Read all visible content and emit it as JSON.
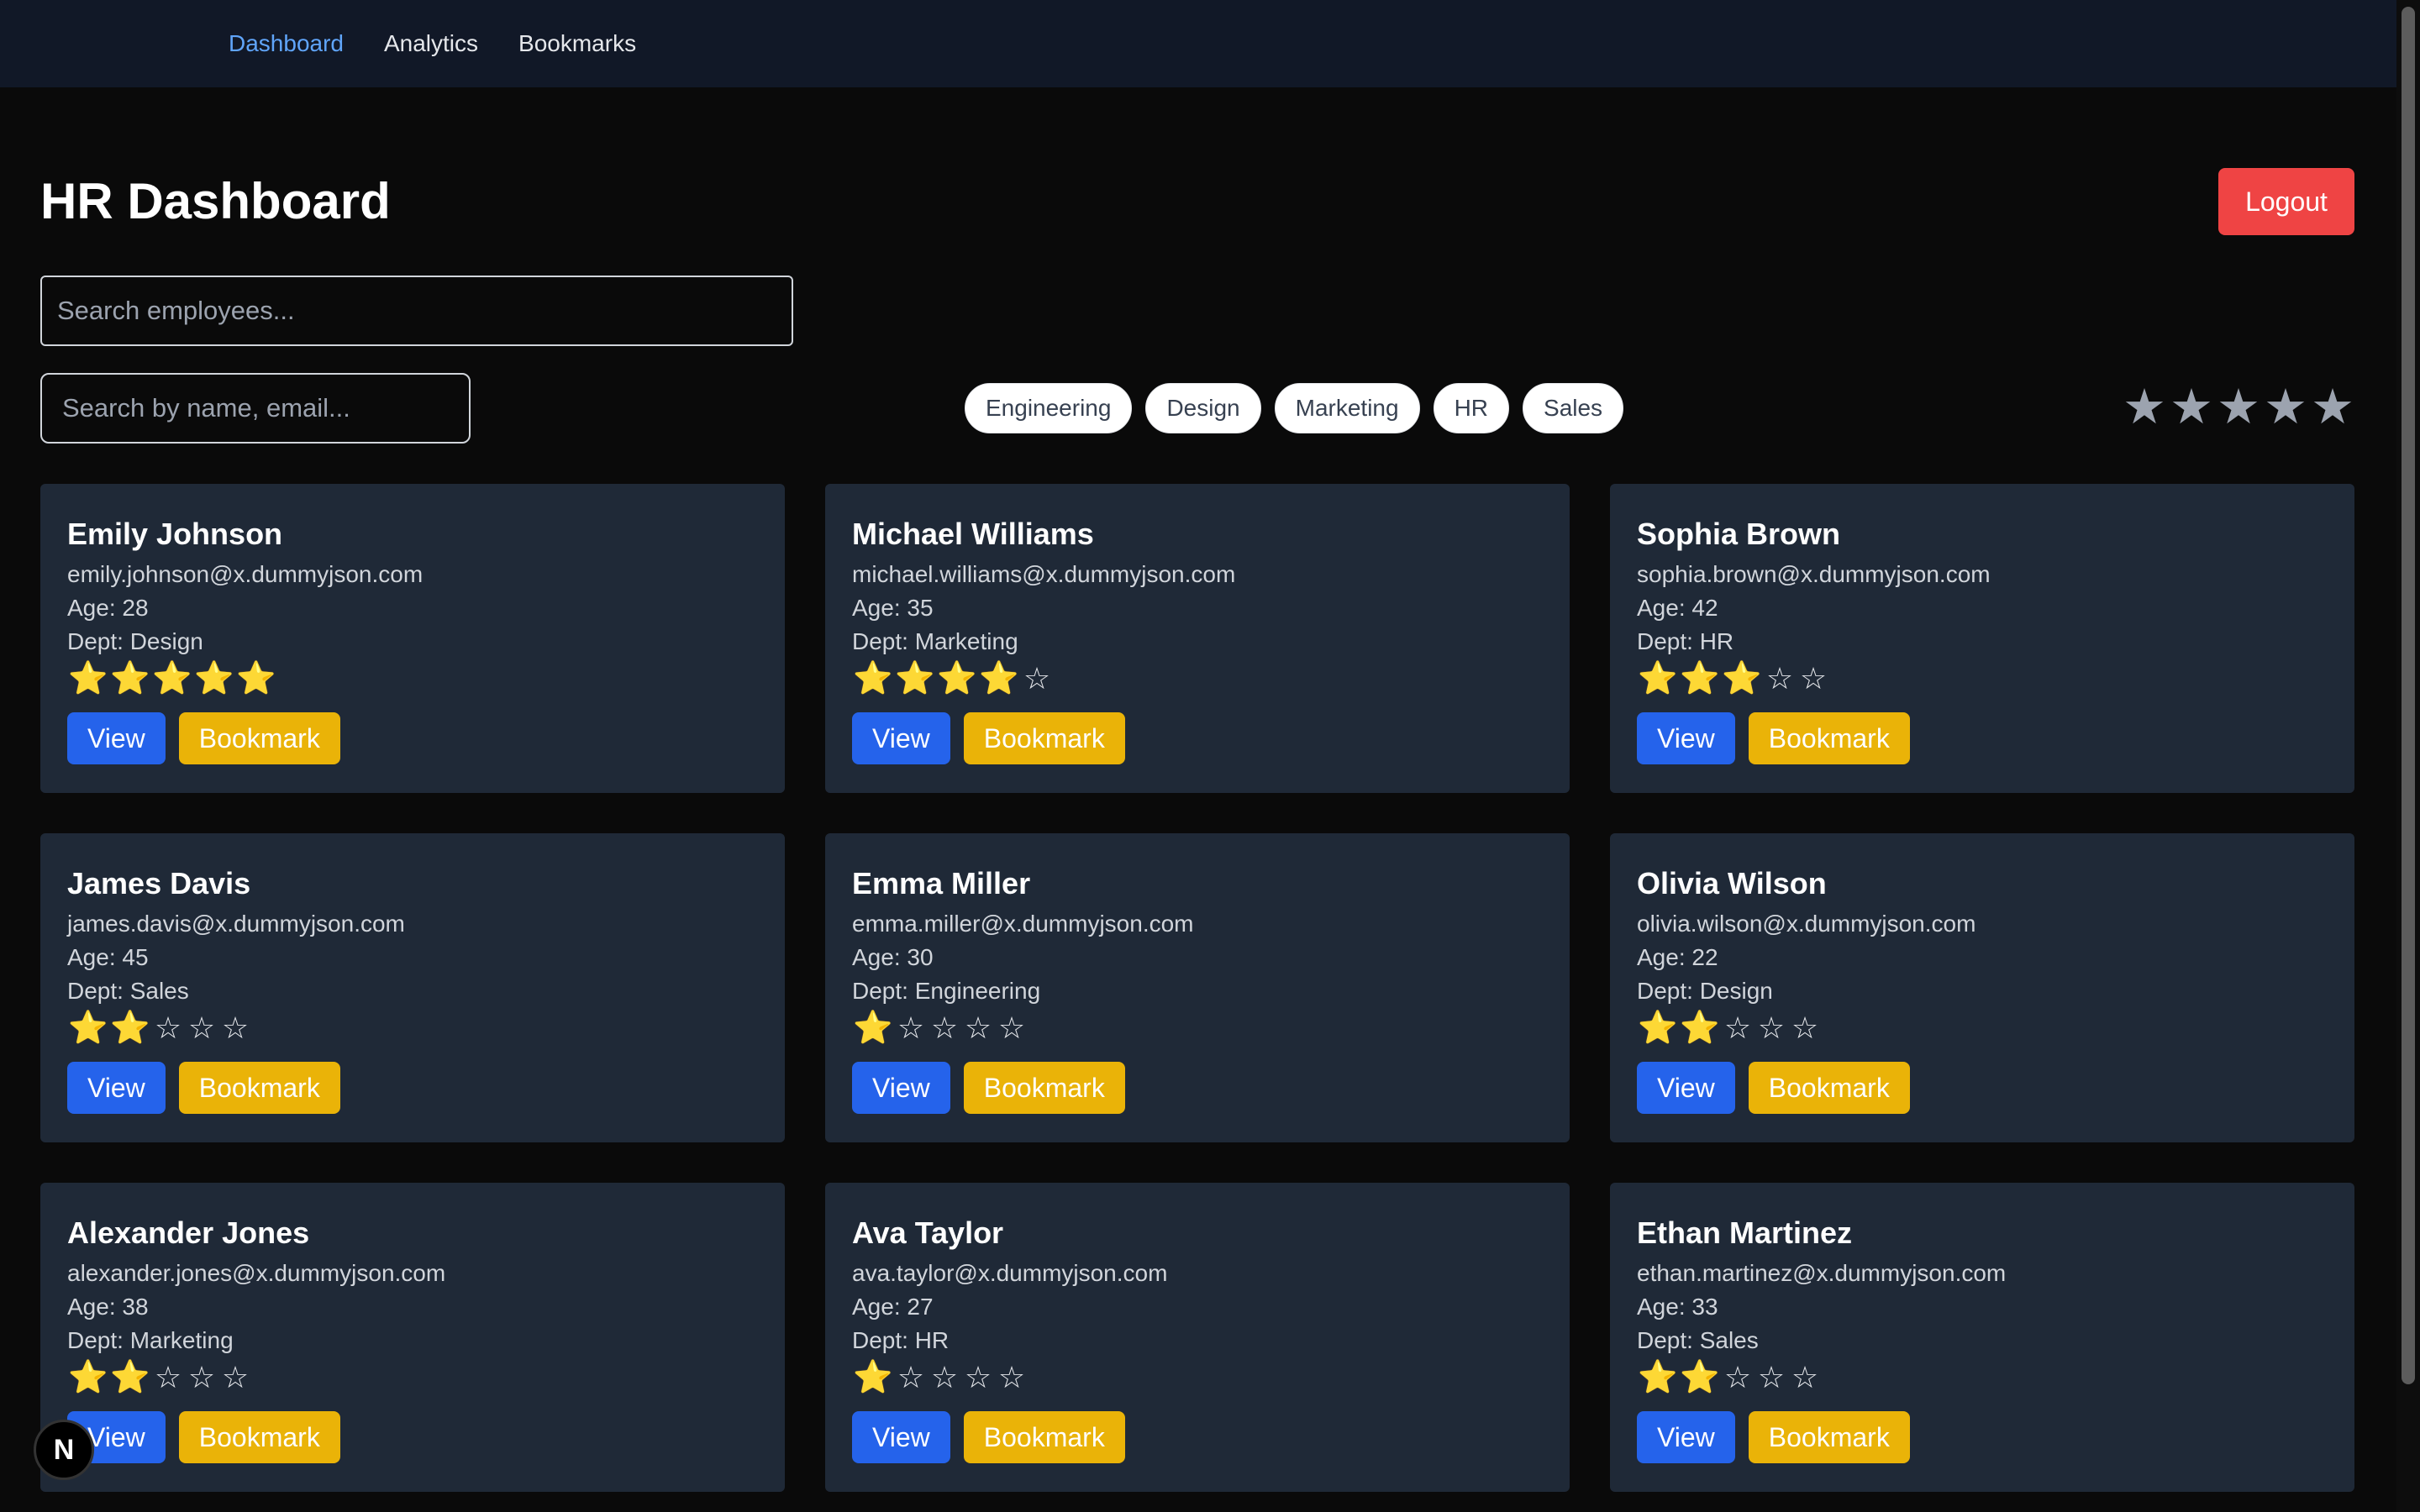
{
  "nav": {
    "links": [
      {
        "label": "Dashboard"
      },
      {
        "label": "Analytics"
      },
      {
        "label": "Bookmarks"
      }
    ]
  },
  "header": {
    "title": "HR Dashboard",
    "logout_label": "Logout"
  },
  "search": {
    "main_placeholder": "Search employees...",
    "secondary_placeholder": "Search by name, email..."
  },
  "filters": {
    "departments": [
      "Engineering",
      "Design",
      "Marketing",
      "HR",
      "Sales"
    ],
    "rating_stars": [
      "★",
      "★",
      "★",
      "★",
      "★"
    ]
  },
  "employees": [
    {
      "name": "Emily Johnson",
      "email": "emily.johnson@x.dummyjson.com",
      "age": "Age: 28",
      "dept": "Dept: Design",
      "rating": 5,
      "view_label": "View",
      "bookmark_label": "Bookmark"
    },
    {
      "name": "Michael Williams",
      "email": "michael.williams@x.dummyjson.com",
      "age": "Age: 35",
      "dept": "Dept: Marketing",
      "rating": 4,
      "view_label": "View",
      "bookmark_label": "Bookmark"
    },
    {
      "name": "Sophia Brown",
      "email": "sophia.brown@x.dummyjson.com",
      "age": "Age: 42",
      "dept": "Dept: HR",
      "rating": 3,
      "view_label": "View",
      "bookmark_label": "Bookmark"
    },
    {
      "name": "James Davis",
      "email": "james.davis@x.dummyjson.com",
      "age": "Age: 45",
      "dept": "Dept: Sales",
      "rating": 2,
      "view_label": "View",
      "bookmark_label": "Bookmark"
    },
    {
      "name": "Emma Miller",
      "email": "emma.miller@x.dummyjson.com",
      "age": "Age: 30",
      "dept": "Dept: Engineering",
      "rating": 1,
      "view_label": "View",
      "bookmark_label": "Bookmark"
    },
    {
      "name": "Olivia Wilson",
      "email": "olivia.wilson@x.dummyjson.com",
      "age": "Age: 22",
      "dept": "Dept: Design",
      "rating": 2,
      "view_label": "View",
      "bookmark_label": "Bookmark"
    },
    {
      "name": "Alexander Jones",
      "email": "alexander.jones@x.dummyjson.com",
      "age": "Age: 38",
      "dept": "Dept: Marketing",
      "rating": 2,
      "view_label": "View",
      "bookmark_label": "Bookmark"
    },
    {
      "name": "Ava Taylor",
      "email": "ava.taylor@x.dummyjson.com",
      "age": "Age: 27",
      "dept": "Dept: HR",
      "rating": 1,
      "view_label": "View",
      "bookmark_label": "Bookmark"
    },
    {
      "name": "Ethan Martinez",
      "email": "ethan.martinez@x.dummyjson.com",
      "age": "Age: 33",
      "dept": "Dept: Sales",
      "rating": 2,
      "view_label": "View",
      "bookmark_label": "Bookmark"
    }
  ],
  "rating_max": 5,
  "star_glyphs": {
    "filled": "⭐",
    "empty": "☆"
  },
  "badge": {
    "label": "N"
  },
  "colors": {
    "background": "#0a0a0a",
    "nav_bg": "#111827",
    "card_bg": "#1f2937",
    "active_link": "#60a5fa",
    "logout": "#ef4444",
    "view_button": "#2563eb",
    "bookmark_button": "#eab308",
    "star": "#fbbf24"
  }
}
